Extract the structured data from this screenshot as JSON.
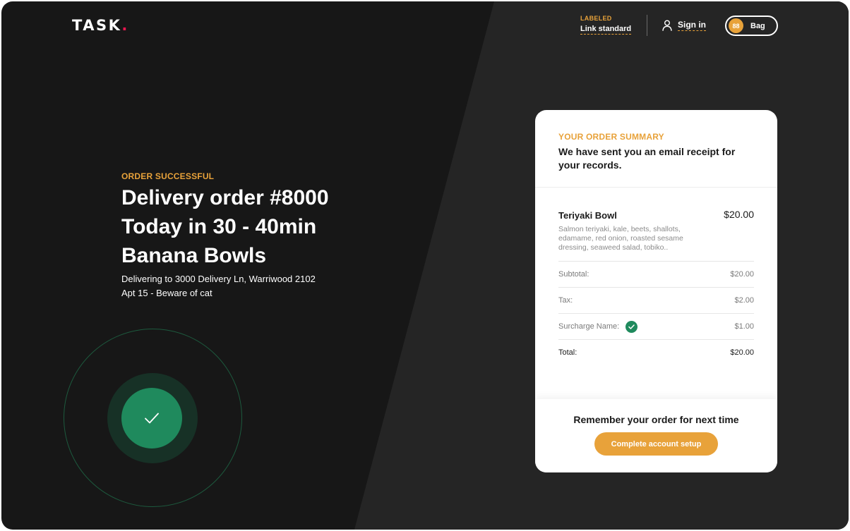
{
  "header": {
    "logo_text": "TASK",
    "logo_dot": ".",
    "labeled_eyebrow": "LABELED",
    "labeled_link": "Link standard",
    "signin_label": "Sign in",
    "bag_count": "88",
    "bag_label": "Bag"
  },
  "hero": {
    "eyebrow": "ORDER SUCCESSFUL",
    "headline_lines": [
      "Delivery order #8000",
      "Today in 30 - 40min",
      "Banana Bowls"
    ],
    "address_line1": "Delivering to 3000 Delivery Ln, Warriwood 2102",
    "address_line2": "Apt 15 - Beware of cat"
  },
  "summary": {
    "eyebrow": "YOUR ORDER SUMMARY",
    "message": "We have sent you an email receipt for your records.",
    "item": {
      "name": "Teriyaki Bowl",
      "price": "$20.00",
      "description": "Salmon teriyaki, kale, beets, shallots, edamame, red onion, roasted sesame dressing, seaweed salad, tobiko.."
    },
    "lines": [
      {
        "label": "Subtotal:",
        "value": "$20.00"
      },
      {
        "label": "Tax:",
        "value": "$2.00"
      },
      {
        "label": "Surcharge Name:",
        "value": "$1.00"
      },
      {
        "label": "Total:",
        "value": "$20.00"
      }
    ],
    "footer_prompt": "Remember your order for next time",
    "cta_label": "Complete account setup"
  },
  "colors": {
    "accent": "#e8a23a",
    "success": "#1f8a5d",
    "logo_dot": "#e8164f",
    "background": "#171717"
  },
  "icons": {
    "signin": "user-icon",
    "success": "checkmark-icon",
    "surcharge": "check-circle-icon"
  }
}
